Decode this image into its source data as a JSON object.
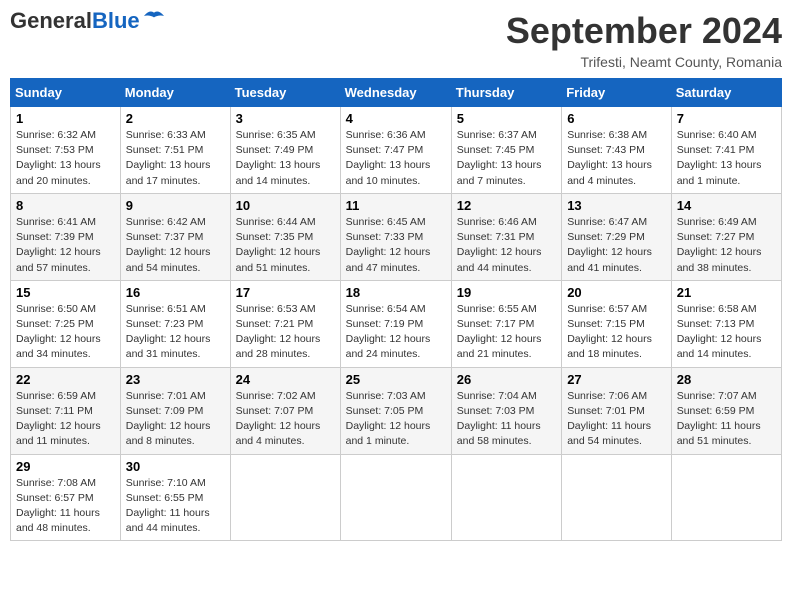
{
  "header": {
    "logo_general": "General",
    "logo_blue": "Blue",
    "month_title": "September 2024",
    "location": "Trifesti, Neamt County, Romania"
  },
  "weekdays": [
    "Sunday",
    "Monday",
    "Tuesday",
    "Wednesday",
    "Thursday",
    "Friday",
    "Saturday"
  ],
  "weeks": [
    [
      {
        "day": "1",
        "sunrise": "6:32 AM",
        "sunset": "7:53 PM",
        "daylight": "13 hours and 20 minutes."
      },
      {
        "day": "2",
        "sunrise": "6:33 AM",
        "sunset": "7:51 PM",
        "daylight": "13 hours and 17 minutes."
      },
      {
        "day": "3",
        "sunrise": "6:35 AM",
        "sunset": "7:49 PM",
        "daylight": "13 hours and 14 minutes."
      },
      {
        "day": "4",
        "sunrise": "6:36 AM",
        "sunset": "7:47 PM",
        "daylight": "13 hours and 10 minutes."
      },
      {
        "day": "5",
        "sunrise": "6:37 AM",
        "sunset": "7:45 PM",
        "daylight": "13 hours and 7 minutes."
      },
      {
        "day": "6",
        "sunrise": "6:38 AM",
        "sunset": "7:43 PM",
        "daylight": "13 hours and 4 minutes."
      },
      {
        "day": "7",
        "sunrise": "6:40 AM",
        "sunset": "7:41 PM",
        "daylight": "13 hours and 1 minute."
      }
    ],
    [
      {
        "day": "8",
        "sunrise": "6:41 AM",
        "sunset": "7:39 PM",
        "daylight": "12 hours and 57 minutes."
      },
      {
        "day": "9",
        "sunrise": "6:42 AM",
        "sunset": "7:37 PM",
        "daylight": "12 hours and 54 minutes."
      },
      {
        "day": "10",
        "sunrise": "6:44 AM",
        "sunset": "7:35 PM",
        "daylight": "12 hours and 51 minutes."
      },
      {
        "day": "11",
        "sunrise": "6:45 AM",
        "sunset": "7:33 PM",
        "daylight": "12 hours and 47 minutes."
      },
      {
        "day": "12",
        "sunrise": "6:46 AM",
        "sunset": "7:31 PM",
        "daylight": "12 hours and 44 minutes."
      },
      {
        "day": "13",
        "sunrise": "6:47 AM",
        "sunset": "7:29 PM",
        "daylight": "12 hours and 41 minutes."
      },
      {
        "day": "14",
        "sunrise": "6:49 AM",
        "sunset": "7:27 PM",
        "daylight": "12 hours and 38 minutes."
      }
    ],
    [
      {
        "day": "15",
        "sunrise": "6:50 AM",
        "sunset": "7:25 PM",
        "daylight": "12 hours and 34 minutes."
      },
      {
        "day": "16",
        "sunrise": "6:51 AM",
        "sunset": "7:23 PM",
        "daylight": "12 hours and 31 minutes."
      },
      {
        "day": "17",
        "sunrise": "6:53 AM",
        "sunset": "7:21 PM",
        "daylight": "12 hours and 28 minutes."
      },
      {
        "day": "18",
        "sunrise": "6:54 AM",
        "sunset": "7:19 PM",
        "daylight": "12 hours and 24 minutes."
      },
      {
        "day": "19",
        "sunrise": "6:55 AM",
        "sunset": "7:17 PM",
        "daylight": "12 hours and 21 minutes."
      },
      {
        "day": "20",
        "sunrise": "6:57 AM",
        "sunset": "7:15 PM",
        "daylight": "12 hours and 18 minutes."
      },
      {
        "day": "21",
        "sunrise": "6:58 AM",
        "sunset": "7:13 PM",
        "daylight": "12 hours and 14 minutes."
      }
    ],
    [
      {
        "day": "22",
        "sunrise": "6:59 AM",
        "sunset": "7:11 PM",
        "daylight": "12 hours and 11 minutes."
      },
      {
        "day": "23",
        "sunrise": "7:01 AM",
        "sunset": "7:09 PM",
        "daylight": "12 hours and 8 minutes."
      },
      {
        "day": "24",
        "sunrise": "7:02 AM",
        "sunset": "7:07 PM",
        "daylight": "12 hours and 4 minutes."
      },
      {
        "day": "25",
        "sunrise": "7:03 AM",
        "sunset": "7:05 PM",
        "daylight": "12 hours and 1 minute."
      },
      {
        "day": "26",
        "sunrise": "7:04 AM",
        "sunset": "7:03 PM",
        "daylight": "11 hours and 58 minutes."
      },
      {
        "day": "27",
        "sunrise": "7:06 AM",
        "sunset": "7:01 PM",
        "daylight": "11 hours and 54 minutes."
      },
      {
        "day": "28",
        "sunrise": "7:07 AM",
        "sunset": "6:59 PM",
        "daylight": "11 hours and 51 minutes."
      }
    ],
    [
      {
        "day": "29",
        "sunrise": "7:08 AM",
        "sunset": "6:57 PM",
        "daylight": "11 hours and 48 minutes."
      },
      {
        "day": "30",
        "sunrise": "7:10 AM",
        "sunset": "6:55 PM",
        "daylight": "11 hours and 44 minutes."
      },
      null,
      null,
      null,
      null,
      null
    ]
  ]
}
